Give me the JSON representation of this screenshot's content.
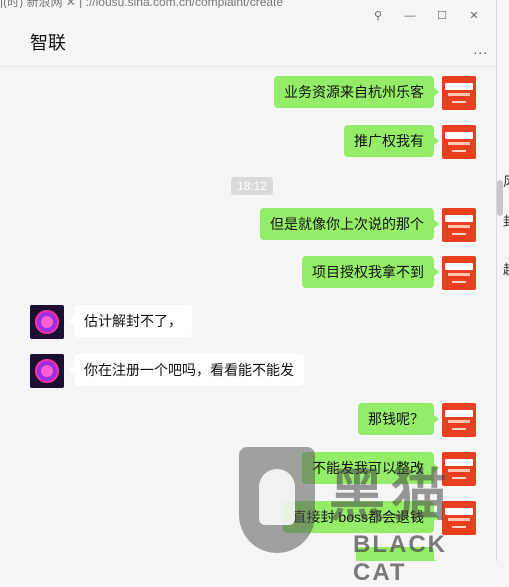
{
  "window": {
    "url_fragment": "|(时) 新浪网 ✕ | ://iousu.sina.com.cn/complaint/create",
    "title": "智联",
    "more_label": "...",
    "buttons": {
      "pin": "⚲",
      "minimize": "—",
      "maximize": "☐",
      "close": "✕"
    }
  },
  "messages": [
    {
      "side": "out",
      "text": "业务资源来自杭州乐客"
    },
    {
      "side": "out",
      "text": "推广权我有"
    },
    {
      "side": "time",
      "text": "18:12"
    },
    {
      "side": "out",
      "text": "但是就像你上次说的那个"
    },
    {
      "side": "out",
      "text": "项目授权我拿不到"
    },
    {
      "side": "in",
      "text": "估计解封不了，"
    },
    {
      "side": "in",
      "text": "你在注册一个吧吗，看看能不能发"
    },
    {
      "side": "out",
      "text": "那钱呢？"
    },
    {
      "side": "out",
      "text": "不能发我可以整改"
    },
    {
      "side": "out",
      "text": "直接封 boss都会退钱"
    }
  ],
  "side_chars": [
    "风",
    "封",
    "赳"
  ],
  "watermark": {
    "big": "黑猫",
    "text": "BLACK CAT"
  },
  "colors": {
    "outgoing": "#95ec69",
    "incoming": "#ffffff",
    "avatar_right": "#e8401e"
  }
}
